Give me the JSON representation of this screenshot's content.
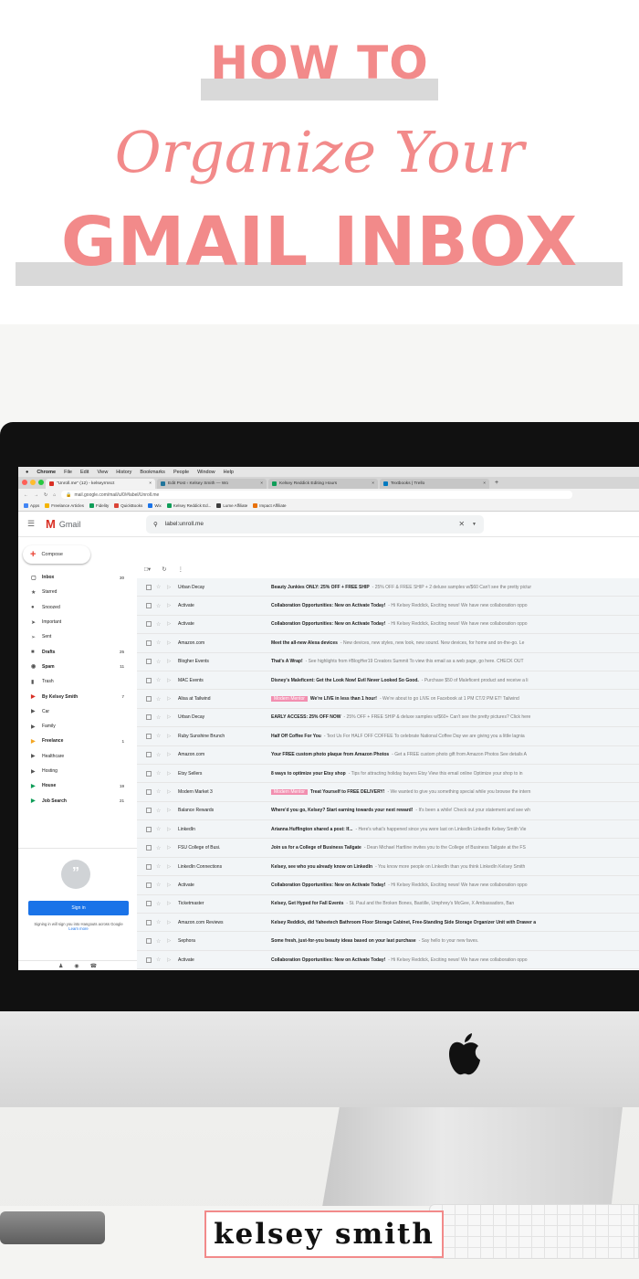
{
  "header": {
    "line1": "HOW TO",
    "line2": "Organize Your",
    "line3": "GMAIL INBOX",
    "accent_color": "#f28a8a"
  },
  "brand": {
    "name": "kelsey smith"
  },
  "mac_menu": [
    "Chrome",
    "File",
    "Edit",
    "View",
    "History",
    "Bookmarks",
    "People",
    "Window",
    "Help"
  ],
  "browser": {
    "tabs": [
      {
        "title": "\"Unroll.me\" (12) - kelseyrmsct",
        "active": true,
        "fav_color": "#d93025"
      },
      {
        "title": "Edit Post ‹ Kelsey Smith — Wo",
        "active": false,
        "fav_color": "#21759b"
      },
      {
        "title": "Kelsey Reddick Editing Hours",
        "active": false,
        "fav_color": "#0f9d58"
      },
      {
        "title": "Textbooks | Trello",
        "active": false,
        "fav_color": "#0079bf"
      }
    ],
    "url": "mail.google.com/mail/u/0/#label/Unroll.me",
    "bookmarks": [
      "Apps",
      "Freelance Articles",
      "Fidelity",
      "QuickBooks",
      "Wix",
      "Kelsey Reddick Ed...",
      "Lume Affiliate",
      "Impact Affiliate"
    ]
  },
  "gmail": {
    "logo_text": "Gmail",
    "search_value": "label:unroll.me",
    "compose_label": "Compose",
    "nav": [
      {
        "icon": "inbox-icon",
        "glyph": "▢",
        "label": "Inbox",
        "count": "30",
        "bold": true
      },
      {
        "icon": "star-icon",
        "glyph": "★",
        "label": "Starred",
        "count": "",
        "bold": false
      },
      {
        "icon": "clock-icon",
        "glyph": "●",
        "label": "Snoozed",
        "count": "",
        "bold": false
      },
      {
        "icon": "important-icon",
        "glyph": "➤",
        "label": "Important",
        "count": "",
        "bold": false
      },
      {
        "icon": "send-icon",
        "glyph": "➢",
        "label": "Sent",
        "count": "",
        "bold": false
      },
      {
        "icon": "draft-icon",
        "glyph": "■",
        "label": "Drafts",
        "count": "25",
        "bold": true
      },
      {
        "icon": "spam-icon",
        "glyph": "◉",
        "label": "Spam",
        "count": "11",
        "bold": true
      },
      {
        "icon": "trash-icon",
        "glyph": "▮",
        "label": "Trash",
        "count": "",
        "bold": false
      },
      {
        "icon": "label-icon",
        "glyph": "▶",
        "label": "By Kelsey Smith",
        "count": "7",
        "bold": true,
        "color": "#d93025"
      },
      {
        "icon": "label-icon",
        "glyph": "▶",
        "label": "Car",
        "count": "",
        "bold": false
      },
      {
        "icon": "label-icon",
        "glyph": "▶",
        "label": "Family",
        "count": "",
        "bold": false
      },
      {
        "icon": "label-icon",
        "glyph": "▶",
        "label": "Freelance",
        "count": "1",
        "bold": true,
        "color": "#f4a623"
      },
      {
        "icon": "label-icon",
        "glyph": "▶",
        "label": "Healthcare",
        "count": "",
        "bold": false
      },
      {
        "icon": "label-icon",
        "glyph": "▶",
        "label": "Hosting",
        "count": "",
        "bold": false
      },
      {
        "icon": "label-icon",
        "glyph": "▶",
        "label": "House",
        "count": "19",
        "bold": true,
        "color": "#0f9d58"
      },
      {
        "icon": "label-icon",
        "glyph": "▶",
        "label": "Job Search",
        "count": "21",
        "bold": true,
        "color": "#0f9d58"
      }
    ],
    "hangouts": {
      "sign_in_label": "Sign in",
      "note": "Signing in will sign you into Hangouts across Google",
      "learn_more": "Learn more"
    },
    "emails": [
      {
        "sender": "Urban Decay",
        "label": "",
        "subject": "Beauty Junkies ONLY: 25% OFF + FREE SHIP",
        "snippet": "- 25% OFF & FREE SHIP + 2 deluxe samples w/$60 Can't see the pretty pictur"
      },
      {
        "sender": "Activate",
        "label": "",
        "subject": "Collaboration Opportunities: New on Activate Today!",
        "snippet": "- Hi Kelsey Reddick, Exciting news! We have new collaboration oppo"
      },
      {
        "sender": "Activate",
        "label": "",
        "subject": "Collaboration Opportunities: New on Activate Today!",
        "snippet": "- Hi Kelsey Reddick, Exciting news! We have new collaboration oppo"
      },
      {
        "sender": "Amazon.com",
        "label": "",
        "subject": "Meet the all-new Alexa devices",
        "snippet": "- New devices, new styles, new look, new sound. New devices, for home and on-the-go. Le"
      },
      {
        "sender": "Blogher Events",
        "label": "",
        "subject": "That's A Wrap!",
        "snippet": "- See highlights from #BlogHer19 Creators Summit To view this email as a web page, go here. CHECK OUT"
      },
      {
        "sender": "MAC Events",
        "label": "",
        "subject": "Disney's Maleficent: Get the Look Now! Evil Never Looked So Good.",
        "snippet": "- Purchase $50 of Maleficent product and receive a li"
      },
      {
        "sender": "Alisa at Tailwind",
        "label": "Modern Mentor",
        "subject": "We're LIVE in less than 1 hour!",
        "snippet": "- We're about to go LIVE on Facebook at 1 PM CT/2 PM ET! Tailwind"
      },
      {
        "sender": "Urban Decay",
        "label": "",
        "subject": "EARLY ACCESS: 25% OFF NOW",
        "snippet": "- 25% OFF + FREE SHIP & deluxe samples w/$60+ Can't see the pretty pictures? Click here"
      },
      {
        "sender": "Ruby Sunshine Brunch",
        "label": "",
        "subject": "Half Off Coffee For You",
        "snippet": "- Text Us For HALF OFF COFFEE To celebrate National Coffee Day we are giving you a little lagnia"
      },
      {
        "sender": "Amazon.com",
        "label": "",
        "subject": "Your FREE custom photo plaque from Amazon Photos",
        "snippet": "- Get a FREE custom photo gift from Amazon Photos See details A"
      },
      {
        "sender": "Etsy Sellers",
        "label": "",
        "subject": "8 ways to optimize your Etsy shop",
        "snippet": "- Tips for attracting holiday buyers Etsy View this email online Optimize your shop to in"
      },
      {
        "sender": "Modern Market 3",
        "label": "Modern Mentor",
        "subject": "Treat Yourself to FREE DELIVERY!",
        "snippet": "- We wanted to give you something special while you browse the intern"
      },
      {
        "sender": "Balance Rewards",
        "label": "",
        "subject": "Where'd you go, Kelsey? Start earning towards your next reward!",
        "snippet": "- It's been a while! Check out your statement and see wh"
      },
      {
        "sender": "LinkedIn",
        "label": "",
        "subject": "Arianna Huffington shared a post: If...",
        "snippet": "- Here's what's happened since you were last on LinkedIn LinkedIn Kelsey Smith Vie"
      },
      {
        "sender": "FSU College of Busi.",
        "label": "",
        "subject": "Join us for a College of Business Tailgate",
        "snippet": "- Dean Michael Hartline invites you to the College of Business Tailgate at the FS"
      },
      {
        "sender": "LinkedIn Connections",
        "label": "",
        "subject": "Kelsey, see who you already know on LinkedIn",
        "snippet": "- You know more people on LinkedIn than you think LinkedIn Kelsey Smith"
      },
      {
        "sender": "Activate",
        "label": "",
        "subject": "Collaboration Opportunities: New on Activate Today!",
        "snippet": "- Hi Kelsey Reddick, Exciting news! We have new collaboration oppo"
      },
      {
        "sender": "Ticketmaster",
        "label": "",
        "subject": "Kelsey, Get Hyped for Fall Events",
        "snippet": "- St. Paul and the Broken Bones, Bastille, Umphrey's McGee, X Ambassadors, Ban"
      },
      {
        "sender": "Amazon.com Reviews",
        "label": "",
        "subject": "Kelsey Reddick, did Yaheetech Bathroom Floor Storage Cabinet, Free-Standing Side Storage Organizer Unit with Drawer a",
        "snippet": ""
      },
      {
        "sender": "Sephora",
        "label": "",
        "subject": "Some fresh, just-for-you beauty ideas based on your last purchase",
        "snippet": "- Say hello to your new faves."
      },
      {
        "sender": "Activate",
        "label": "",
        "subject": "Collaboration Opportunities: New on Activate Today!",
        "snippet": "- Hi Kelsey Reddick, Exciting news! We have new collaboration oppo"
      }
    ]
  }
}
